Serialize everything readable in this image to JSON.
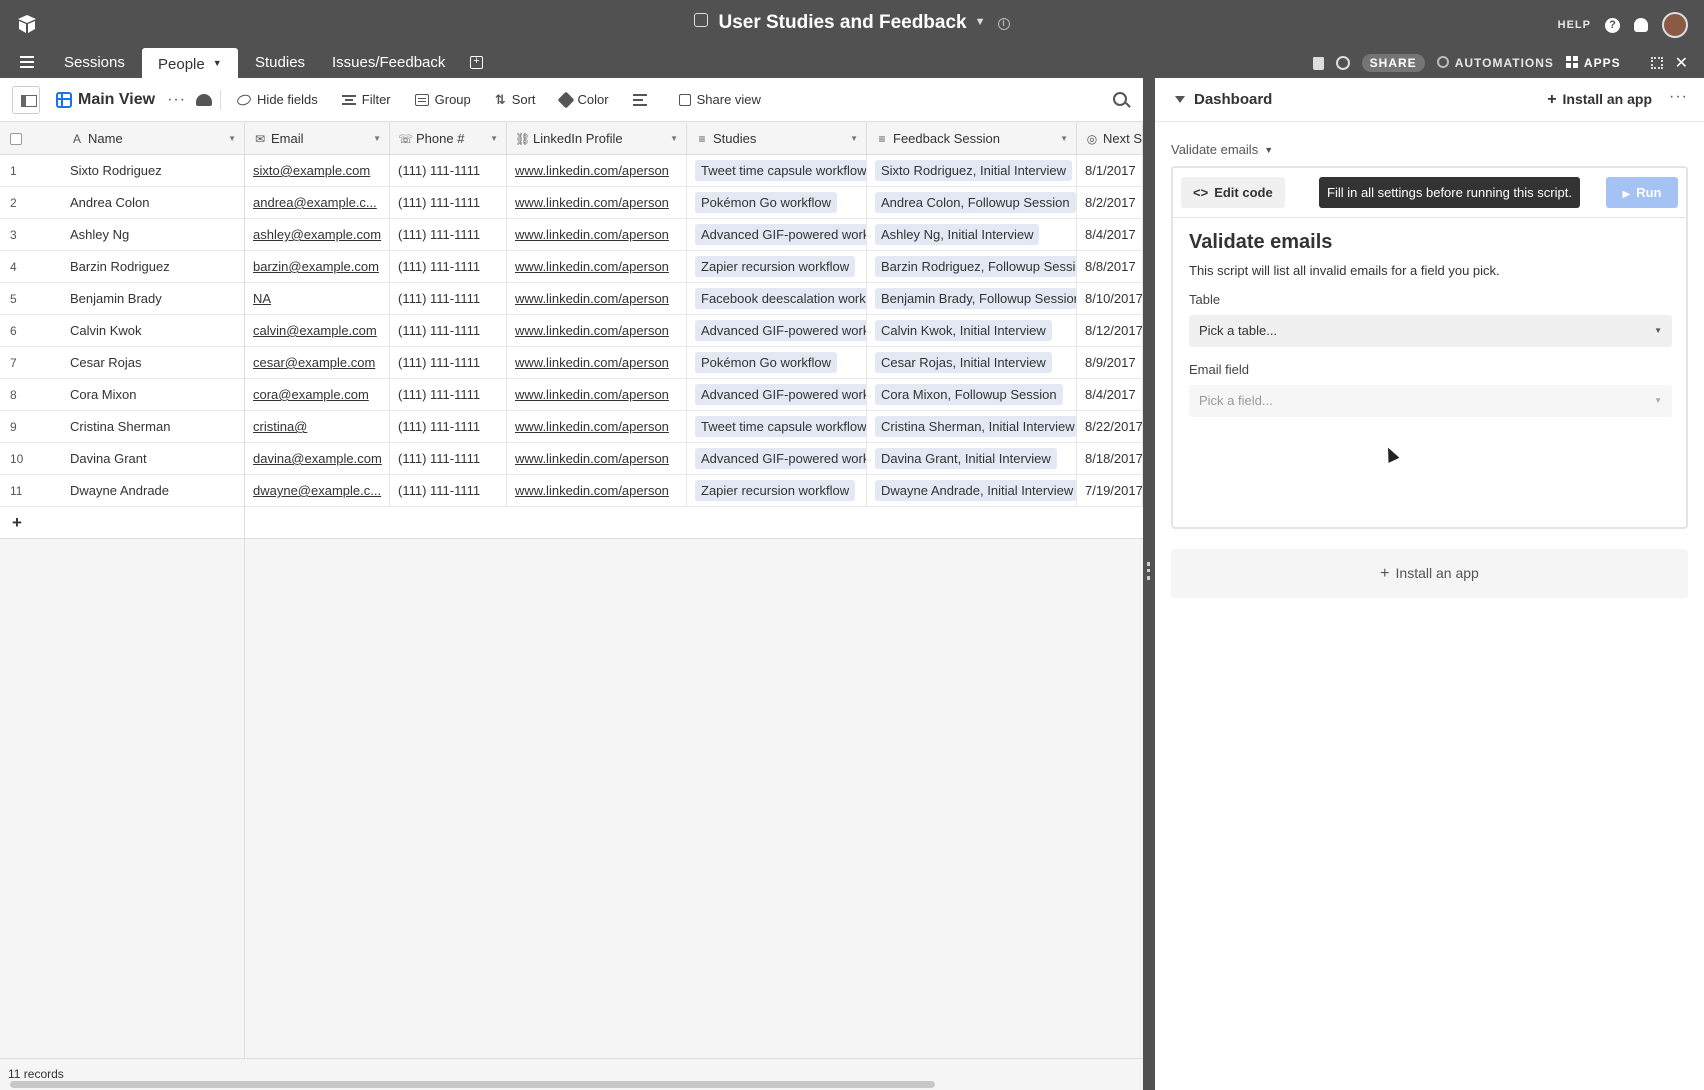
{
  "base": {
    "title": "User Studies and Feedback"
  },
  "top_right": {
    "help_label": "HELP"
  },
  "tabs": [
    {
      "label": "Sessions"
    },
    {
      "label": "People",
      "active": true
    },
    {
      "label": "Studies"
    },
    {
      "label": "Issues/Feedback"
    }
  ],
  "tab_right": {
    "share_label": "SHARE",
    "automations_label": "AUTOMATIONS",
    "apps_label": "APPS"
  },
  "viewbar": {
    "view_name": "Main View",
    "hide_fields": "Hide fields",
    "filter": "Filter",
    "group": "Group",
    "sort": "Sort",
    "color": "Color",
    "share_view": "Share view"
  },
  "columns": [
    {
      "label": "Name",
      "icon": "A"
    },
    {
      "label": "Email",
      "icon": "✉"
    },
    {
      "label": "Phone #",
      "icon": "☏"
    },
    {
      "label": "LinkedIn Profile",
      "icon": "⛓"
    },
    {
      "label": "Studies",
      "icon": "≡"
    },
    {
      "label": "Feedback Session",
      "icon": "≡"
    },
    {
      "label": "Next S",
      "icon": "◎"
    }
  ],
  "rows": [
    {
      "n": "1",
      "name": "Sixto Rodriguez",
      "email": "sixto@example.com",
      "phone": "(111) 111-1111",
      "linkedin": "www.linkedin.com/aperson",
      "study": "Tweet time capsule workflow",
      "session": "Sixto Rodriguez, Initial Interview",
      "next": "8/1/2017"
    },
    {
      "n": "2",
      "name": "Andrea Colon",
      "email": "andrea@example.c...",
      "phone": "(111) 111-1111",
      "linkedin": "www.linkedin.com/aperson",
      "study": "Pokémon Go workflow",
      "session": "Andrea Colon, Followup Session",
      "next": "8/2/2017"
    },
    {
      "n": "3",
      "name": "Ashley Ng",
      "email": "ashley@example.com",
      "phone": "(111) 111-1111",
      "linkedin": "www.linkedin.com/aperson",
      "study": "Advanced GIF-powered workflow",
      "session": "Ashley Ng, Initial Interview",
      "next": "8/4/2017"
    },
    {
      "n": "4",
      "name": "Barzin Rodriguez",
      "email": "barzin@example.com",
      "phone": "(111) 111-1111",
      "linkedin": "www.linkedin.com/aperson",
      "study": "Zapier recursion workflow",
      "session": "Barzin Rodriguez, Followup Session",
      "next": "8/8/2017"
    },
    {
      "n": "5",
      "name": "Benjamin Brady",
      "email": "NA",
      "phone": "(111) 111-1111",
      "linkedin": "www.linkedin.com/aperson",
      "study": "Facebook deescalation workflow",
      "session": "Benjamin Brady, Followup Session",
      "next": "8/10/2017"
    },
    {
      "n": "6",
      "name": "Calvin Kwok",
      "email": "calvin@example.com",
      "phone": "(111) 111-1111",
      "linkedin": "www.linkedin.com/aperson",
      "study": "Advanced GIF-powered workflow",
      "session": "Calvin Kwok, Initial Interview",
      "next": "8/12/2017"
    },
    {
      "n": "7",
      "name": "Cesar Rojas",
      "email": "cesar@example.com",
      "phone": "(111) 111-1111",
      "linkedin": "www.linkedin.com/aperson",
      "study": "Pokémon Go workflow",
      "session": "Cesar Rojas, Initial Interview",
      "next": "8/9/2017"
    },
    {
      "n": "8",
      "name": "Cora Mixon",
      "email": "cora@example.com",
      "phone": "(111) 111-1111",
      "linkedin": "www.linkedin.com/aperson",
      "study": "Advanced GIF-powered workflow",
      "session": "Cora Mixon, Followup Session",
      "next": "8/4/2017"
    },
    {
      "n": "9",
      "name": "Cristina Sherman",
      "email": "cristina@",
      "phone": "(111) 111-1111",
      "linkedin": "www.linkedin.com/aperson",
      "study": "Tweet time capsule workflow",
      "session": "Cristina Sherman, Initial Interview",
      "next": "8/22/2017"
    },
    {
      "n": "10",
      "name": "Davina Grant",
      "email": "davina@example.com",
      "phone": "(111) 111-1111",
      "linkedin": "www.linkedin.com/aperson",
      "study": "Advanced GIF-powered workflow",
      "session": "Davina Grant, Initial Interview",
      "next": "8/18/2017"
    },
    {
      "n": "11",
      "name": "Dwayne Andrade",
      "email": "dwayne@example.c...",
      "phone": "(111) 111-1111",
      "linkedin": "www.linkedin.com/aperson",
      "study": "Zapier recursion workflow",
      "session": "Dwayne Andrade, Initial Interview",
      "next": "7/19/2017"
    }
  ],
  "footer": {
    "record_count": "11 records"
  },
  "dashboard": {
    "title": "Dashboard",
    "install_label": "Install an app",
    "app_label": "Validate emails",
    "edit_code": "Edit code",
    "tooltip": "Fill in all settings before running this script.",
    "run": "Run",
    "script_title": "Validate emails",
    "script_desc": "This script will list all invalid emails for a field you pick.",
    "table_label": "Table",
    "table_placeholder": "Pick a table...",
    "email_label": "Email field",
    "email_placeholder": "Pick a field...",
    "install_bottom": "Install an app"
  },
  "colors": {
    "chrome": "#515151",
    "chip": "#e3e8f2",
    "run_disabled": "#a4c2f4",
    "view_icon": "#1b73e8"
  }
}
